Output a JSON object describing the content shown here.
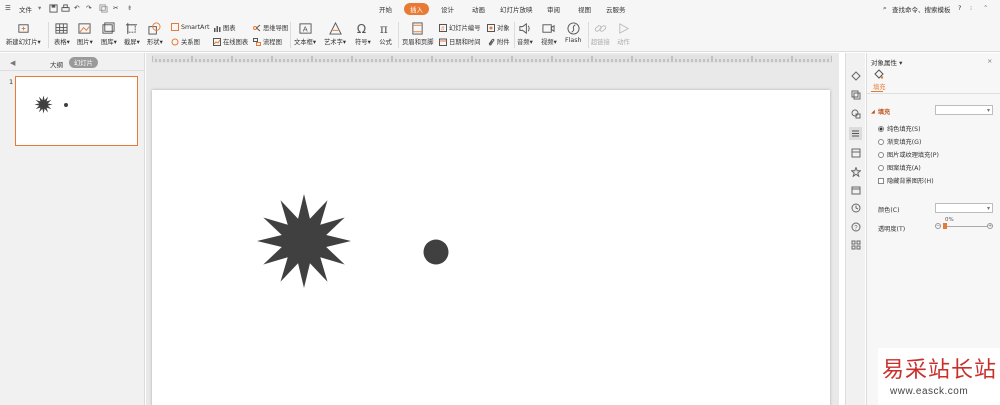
{
  "menubar": {
    "file": "文件",
    "tabs": [
      "开始",
      "插入",
      "设计",
      "动画",
      "幻灯片放映",
      "审阅",
      "视图",
      "云服务"
    ],
    "active_tab": "插入",
    "search_placeholder": "查找命令、搜索模板",
    "help": "?"
  },
  "ribbon": {
    "new_slide": "新建幻灯片",
    "table": "表格",
    "picture": "图片",
    "gallery": "图库",
    "screenshot": "截屏",
    "shape": "形状",
    "smartart": "SmartArt",
    "relation": "关系图",
    "chart": "图表",
    "online_chart": "在线图表",
    "mindmap": "思维导图",
    "flowchart": "流程图",
    "textbox": "文本框",
    "wordart": "艺术字",
    "symbol": "符号",
    "formula": "公式",
    "header_footer": "页眉和页脚",
    "slide_number": "幻灯片编号",
    "date_time": "日期和时间",
    "object": "对象",
    "attachment": "附件",
    "audio": "音频",
    "video": "视频",
    "flash": "Flash",
    "hyperlink": "超链接",
    "action": "动作"
  },
  "leftpanel": {
    "tab_outline": "大纲",
    "tab_slides": "幻灯片",
    "slide_number": "1"
  },
  "props": {
    "title": "对象属性",
    "tab_fill": "填充",
    "section_fill": "填充",
    "options": [
      "纯色填充(S)",
      "渐变填充(G)",
      "图片或纹理填充(P)",
      "图案填充(A)"
    ],
    "selected_option": 0,
    "hide_bg": "隐藏背景图形(H)",
    "color_label": "颜色(C)",
    "transparency_label": "透明度(T)",
    "transparency_value": "0%"
  },
  "colors": {
    "accent": "#e97a36",
    "shape_fill": "#404040"
  },
  "watermark": {
    "cn": "易采站长站",
    "url": "www.easck.com"
  }
}
